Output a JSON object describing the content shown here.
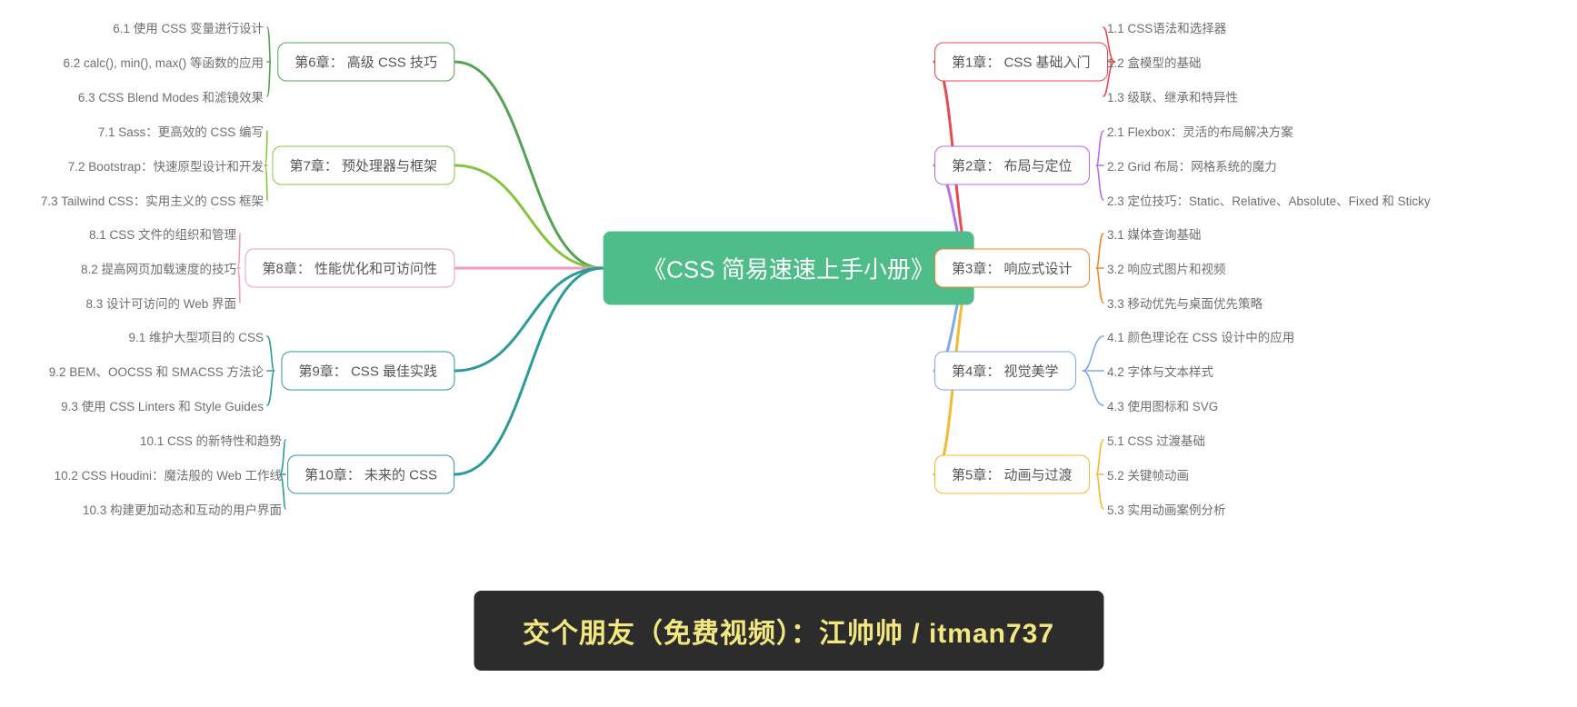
{
  "title": "《CSS 简易速速上手小册》",
  "banner": "交个朋友（免费视频）：江帅帅 / itman737",
  "colors": [
    "#e84b4f",
    "#b56df0",
    "#f08627",
    "#7ea9e8",
    "#f4b92e",
    "#54a354",
    "#86c440",
    "#f29db5",
    "#2d9a9a",
    "#2d9a9a"
  ],
  "right": [
    {
      "label": "第1章： CSS 基础入门",
      "leaves": [
        "1.1 CSS语法和选择器",
        "1.2 盒模型的基础",
        "1.3 级联、继承和特异性"
      ]
    },
    {
      "label": "第2章： 布局与定位",
      "leaves": [
        "2.1 Flexbox：灵活的布局解决方案",
        "2.2 Grid 布局：网格系统的魔力",
        "2.3 定位技巧：Static、Relative、Absolute、Fixed 和 Sticky"
      ]
    },
    {
      "label": "第3章： 响应式设计",
      "leaves": [
        "3.1 媒体查询基础",
        "3.2 响应式图片和视频",
        "3.3 移动优先与桌面优先策略"
      ]
    },
    {
      "label": "第4章： 视觉美学",
      "leaves": [
        "4.1 颜色理论在 CSS 设计中的应用",
        "4.2 字体与文本样式",
        "4.3 使用图标和 SVG"
      ]
    },
    {
      "label": "第5章： 动画与过渡",
      "leaves": [
        "5.1 CSS 过渡基础",
        "5.2 关键帧动画",
        "5.3 实用动画案例分析"
      ]
    }
  ],
  "left": [
    {
      "label": "第6章： 高级 CSS 技巧",
      "leaves": [
        "6.1 使用 CSS 变量进行设计",
        "6.2 calc(), min(), max() 等函数的应用",
        "6.3 CSS Blend Modes 和滤镜效果"
      ]
    },
    {
      "label": "第7章： 预处理器与框架",
      "leaves": [
        "7.1 Sass：更高效的 CSS 编写",
        "7.2 Bootstrap：快速原型设计和开发",
        "7.3 Tailwind CSS：实用主义的 CSS 框架"
      ]
    },
    {
      "label": "第8章： 性能优化和可访问性",
      "leaves": [
        "8.1 CSS 文件的组织和管理",
        "8.2 提高网页加载速度的技巧",
        "8.3 设计可访问的 Web 界面"
      ]
    },
    {
      "label": "第9章： CSS 最佳实践",
      "leaves": [
        "9.1 维护大型项目的 CSS",
        "9.2 BEM、OOCSS 和 SMACSS 方法论",
        "9.3 使用 CSS Linters 和 Style Guides"
      ]
    },
    {
      "label": "第10章： 未来的 CSS",
      "leaves": [
        "10.1 CSS 的新特性和趋势",
        "10.2 CSS Houdini：魔法般的 Web 工作线",
        "10.3 构建更加动态和互动的用户界面"
      ]
    }
  ]
}
